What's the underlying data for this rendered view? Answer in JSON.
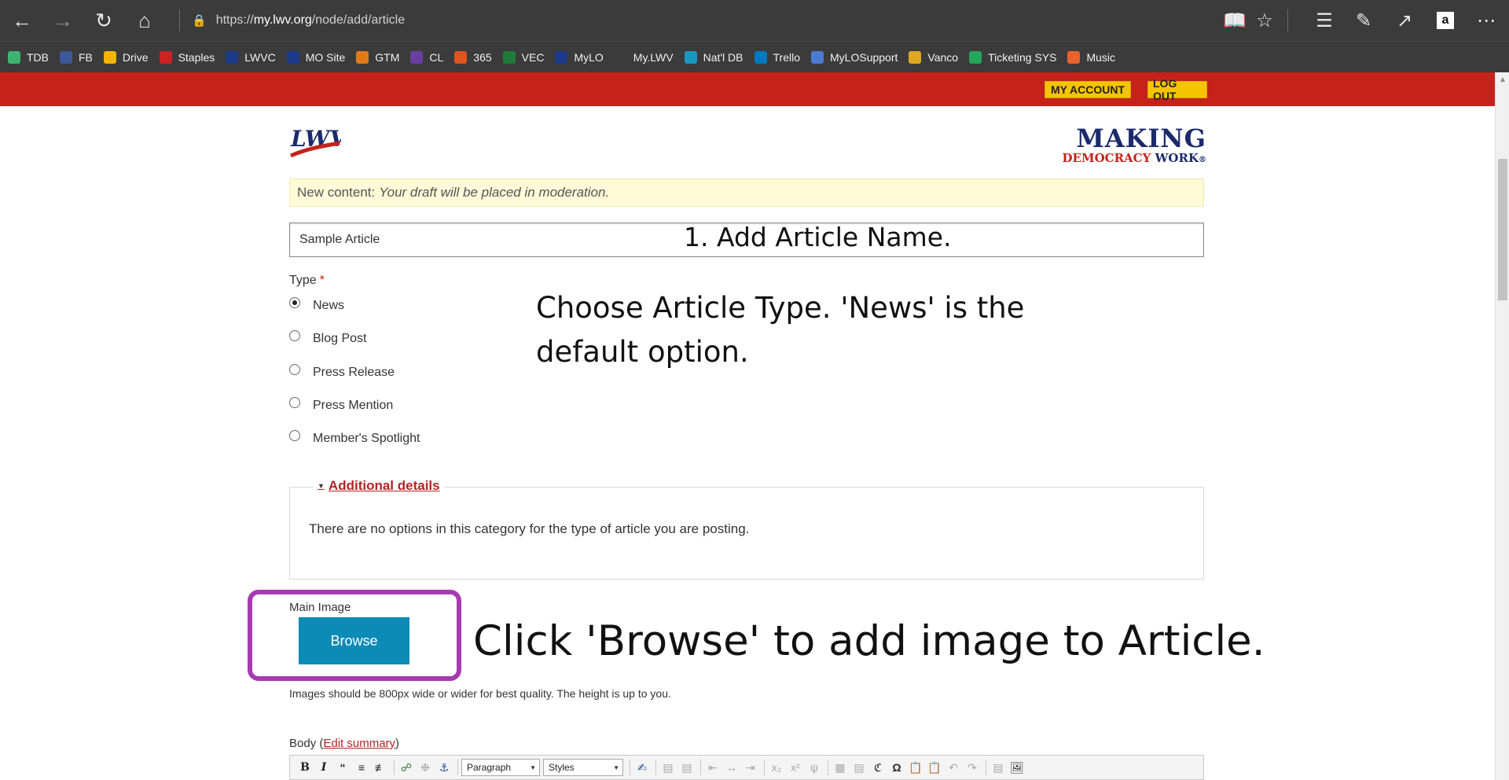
{
  "browser": {
    "url_prefix": "https://",
    "url_host": "my.lwv.org",
    "url_path": "/node/add/article"
  },
  "bookmarks": [
    {
      "label": "TDB",
      "icon": "leaf-icon",
      "color": "#3cb371"
    },
    {
      "label": "FB",
      "icon": "facebook-icon",
      "color": "#3b5998"
    },
    {
      "label": "Drive",
      "icon": "drive-icon",
      "color": "#f4b400"
    },
    {
      "label": "Staples",
      "icon": "staples-icon",
      "color": "#cc2222"
    },
    {
      "label": "LWVC",
      "icon": "lwv-icon",
      "color": "#1b3a8a"
    },
    {
      "label": "MO Site",
      "icon": "lwv-icon",
      "color": "#1b3a8a"
    },
    {
      "label": "GTM",
      "icon": "gtm-icon",
      "color": "#e07b1a"
    },
    {
      "label": "CL",
      "icon": "peace-icon",
      "color": "#6b3fa0"
    },
    {
      "label": "365",
      "icon": "office-icon",
      "color": "#e0541f"
    },
    {
      "label": "VEC",
      "icon": "sheet-icon",
      "color": "#1e7b3a"
    },
    {
      "label": "MyLO",
      "icon": "lwv-icon",
      "color": "#1b3a8a"
    },
    {
      "label": "My.LWV",
      "icon": "star-icon",
      "color": "#3b3b3b"
    },
    {
      "label": "Nat'l DB",
      "icon": "salesforce-icon",
      "color": "#1798c1"
    },
    {
      "label": "Trello",
      "icon": "trello-icon",
      "color": "#0079bf"
    },
    {
      "label": "MyLOSupport",
      "icon": "support-icon",
      "color": "#4a7bd0"
    },
    {
      "label": "Vanco",
      "icon": "vanco-icon",
      "color": "#e0a820"
    },
    {
      "label": "Ticketing SYS",
      "icon": "ticket-icon",
      "color": "#22a85a"
    },
    {
      "label": "Music",
      "icon": "music-icon",
      "color": "#e8622c"
    }
  ],
  "site": {
    "my_account": "MY ACCOUNT",
    "log_out": "LOG OUT",
    "logo_text": "LWV",
    "mdw_top": "MAKING",
    "mdw_democracy": "DEMOCRACY",
    "mdw_work": "WORK",
    "mdw_reg": "®"
  },
  "notice": {
    "label": "New content:",
    "message": "Your draft will be placed in moderation."
  },
  "title_field": {
    "value": "Sample Article"
  },
  "type": {
    "label": "Type",
    "required_mark": "*",
    "options": [
      {
        "label": "News",
        "checked": true
      },
      {
        "label": "Blog Post",
        "checked": false
      },
      {
        "label": "Press Release",
        "checked": false
      },
      {
        "label": "Press Mention",
        "checked": false
      },
      {
        "label": "Member's Spotlight",
        "checked": false
      }
    ]
  },
  "additional_details": {
    "legend": "Additional details",
    "text": "There are no options in this category for the type of article you are posting."
  },
  "main_image": {
    "label": "Main Image",
    "browse": "Browse",
    "note": "Images should be 800px wide or wider for best quality. The height is up to you."
  },
  "body": {
    "label": "Body (",
    "edit_summary": "Edit summary",
    "label_close": ")",
    "format_select": "Paragraph",
    "styles_select": "Styles"
  },
  "annotations": {
    "step1": "1. Add Article Name.",
    "type_line1": "Choose Article Type. 'News' is the",
    "type_line2": "default option.",
    "browse": "Click 'Browse' to add image to Article."
  },
  "colors": {
    "site_red": "#c4221b",
    "account_yellow": "#f5c400",
    "browse_blue": "#0b8bb5",
    "highlight_purple": "#a63bb1"
  }
}
